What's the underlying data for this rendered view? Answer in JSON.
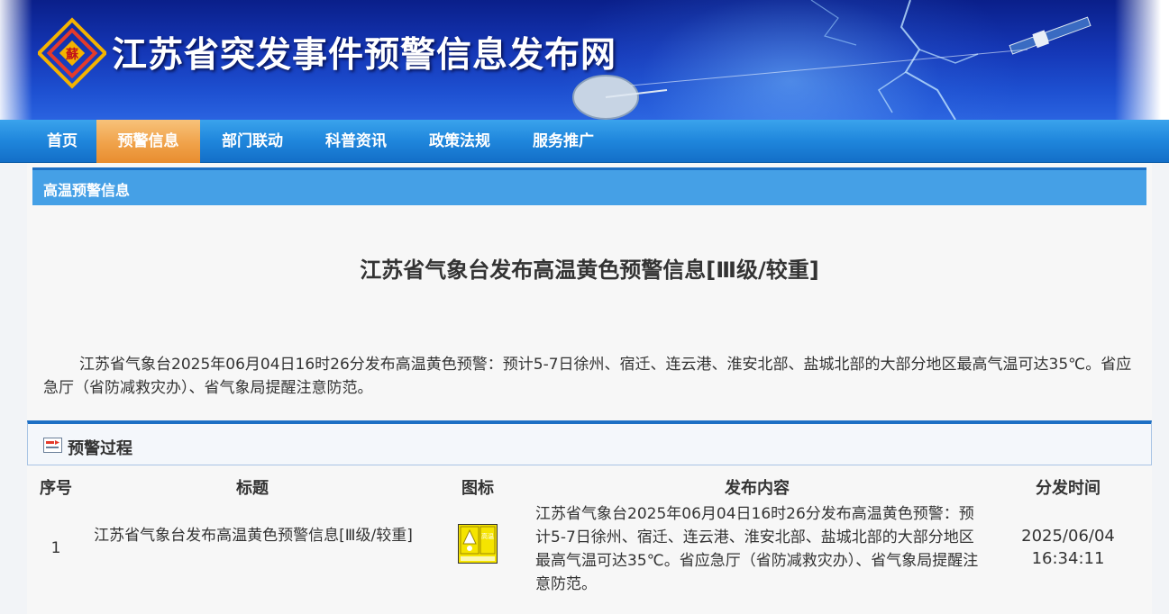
{
  "site": {
    "title": "江苏省突发事件预警信息发布网",
    "logo_char": "蘇"
  },
  "nav": {
    "items": [
      {
        "label": "首页",
        "active": false
      },
      {
        "label": "预警信息",
        "active": true
      },
      {
        "label": "部门联动",
        "active": false
      },
      {
        "label": "科普资讯",
        "active": false
      },
      {
        "label": "政策法规",
        "active": false
      },
      {
        "label": "服务推广",
        "active": false
      }
    ]
  },
  "section": {
    "title": "高温预警信息"
  },
  "article": {
    "title": "江苏省气象台发布高温黄色预警信息[Ⅲ级/较重]",
    "body": "江苏省气象台2025年06月04日16时26分发布高温黄色预警：预计5-7日徐州、宿迁、连云港、淮安北部、盐城北部的大部分地区最高气温可达35℃。省应急厅（省防减救灾办）、省气象局提醒注意防范。"
  },
  "process": {
    "title": "预警过程",
    "columns": [
      "序号",
      "标题",
      "图标",
      "发布内容",
      "分发时间"
    ],
    "rows": [
      {
        "index": "1",
        "title": "江苏省气象台发布高温黄色预警信息[Ⅲ级/较重]",
        "icon_text": "高温",
        "content": "江苏省气象台2025年06月04日16时26分发布高温黄色预警：预计5-7日徐州、宿迁、连云港、淮安北部、盐城北部的大部分地区最高气温可达35℃。省应急厅（省防减救灾办）、省气象局提醒注意防范。",
        "date": "2025/06/04",
        "time": "16:34:11"
      }
    ]
  },
  "colors": {
    "nav_active": "#f0a24a",
    "nav_bg": "#1f86dc",
    "section_bar": "#45a0e6",
    "warn_yellow": "#f5e400"
  }
}
